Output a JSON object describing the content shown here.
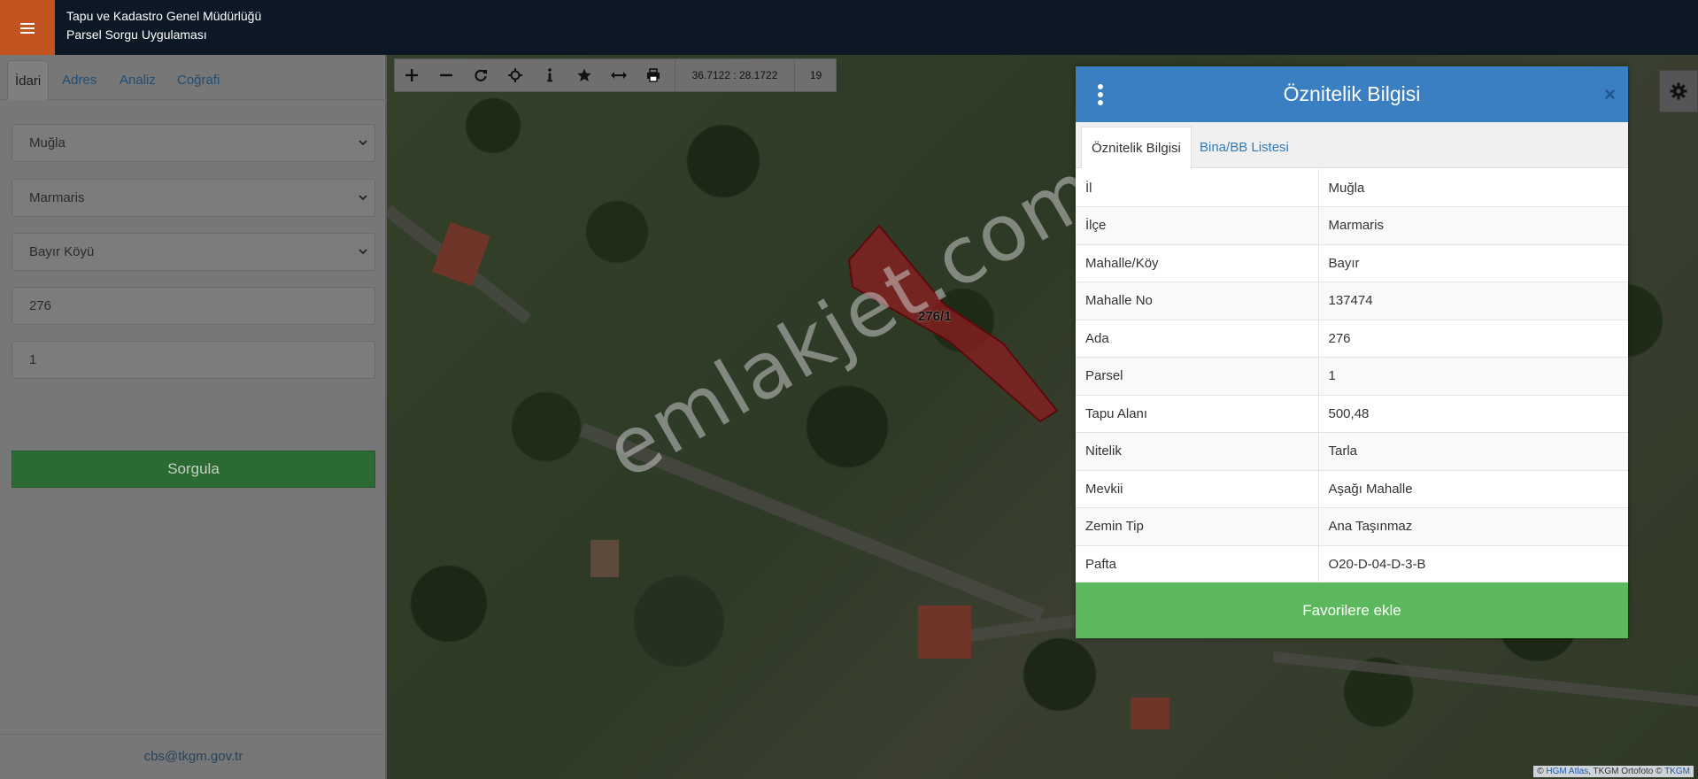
{
  "header": {
    "line1": "Tapu ve Kadastro Genel Müdürlüğü",
    "line2": "Parsel Sorgu Uygulaması"
  },
  "sidebar": {
    "tabs": [
      "İdari",
      "Adres",
      "Analiz",
      "Coğrafi"
    ],
    "fields": {
      "il": "Muğla",
      "ilce": "Marmaris",
      "mahalle": "Bayır Köyü",
      "ada": "276",
      "parsel": "1"
    },
    "submit_label": "Sorgula",
    "footer_email": "cbs@tkgm.gov.tr"
  },
  "map": {
    "coordinates": "36.7122 : 28.1722",
    "zoom": "19",
    "parcel_label": "276/1",
    "watermark": "emlakjet.com",
    "attribution": {
      "prefix": "©",
      "hgm": "HGM Atlas",
      "middle": ", TKGM Ortofoto ©",
      "tkgm": "TKGM"
    }
  },
  "dialog": {
    "title": "Öznitelik Bilgisi",
    "close_glyph": "×",
    "tabs": [
      "Öznitelik Bilgisi",
      "Bina/BB Listesi"
    ],
    "rows": [
      {
        "key": "İl",
        "value": "Muğla"
      },
      {
        "key": "İlçe",
        "value": "Marmaris"
      },
      {
        "key": "Mahalle/Köy",
        "value": "Bayır"
      },
      {
        "key": "Mahalle No",
        "value": "137474"
      },
      {
        "key": "Ada",
        "value": "276"
      },
      {
        "key": "Parsel",
        "value": "1"
      },
      {
        "key": "Tapu Alanı",
        "value": "500,48"
      },
      {
        "key": "Nitelik",
        "value": "Tarla"
      },
      {
        "key": "Mevkii",
        "value": "Aşağı Mahalle"
      },
      {
        "key": "Zemin Tip",
        "value": "Ana Taşınmaz"
      },
      {
        "key": "Pafta",
        "value": "O20-D-04-D-3-B"
      }
    ],
    "favorite_label": "Favorilere ekle"
  },
  "colors": {
    "topbar": "#0c1825",
    "menu_button": "#c2551f",
    "dialog_header": "#3a7fc1",
    "favorite_button": "#5cb85c",
    "parcel_fill": "#8e1e22"
  },
  "icons": [
    "menu-icon",
    "zoom-in-icon",
    "zoom-out-icon",
    "refresh-icon",
    "locate-icon",
    "info-icon",
    "star-icon",
    "measure-icon",
    "print-icon",
    "settings-icon",
    "kebab-icon",
    "close-icon",
    "chevron-down-icon"
  ]
}
